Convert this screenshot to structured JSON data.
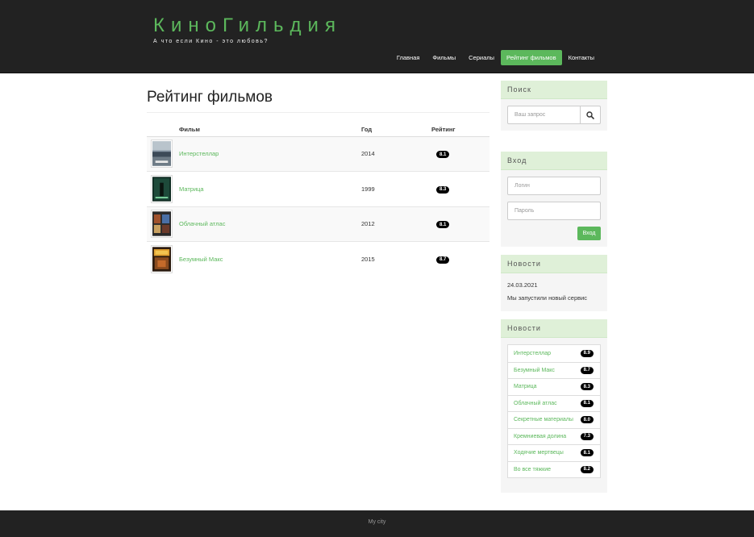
{
  "header": {
    "brand": "КиноГильдия",
    "tagline": "А что если Кино - это любовь?",
    "nav": [
      {
        "label": "Главная",
        "active": false
      },
      {
        "label": "Фильмы",
        "active": false
      },
      {
        "label": "Сериалы",
        "active": false
      },
      {
        "label": "Рейтинг фильмов",
        "active": true
      },
      {
        "label": "Контакты",
        "active": false
      }
    ]
  },
  "main": {
    "title": "Рейтинг фильмов",
    "table": {
      "headers": {
        "film": "Фильм",
        "year": "Год",
        "rating": "Рейтинг"
      },
      "rows": [
        {
          "film": "Интерстеллар",
          "year": "2014",
          "rating": "8.1",
          "poster_icon": "interstellar-poster-icon"
        },
        {
          "film": "Матрица",
          "year": "1999",
          "rating": "8.3",
          "poster_icon": "matrix-poster-icon"
        },
        {
          "film": "Облачный атлас",
          "year": "2012",
          "rating": "8.1",
          "poster_icon": "cloud-atlas-poster-icon"
        },
        {
          "film": "Безумный Макс",
          "year": "2015",
          "rating": "8.7",
          "poster_icon": "mad-max-poster-icon"
        }
      ]
    }
  },
  "sidebar": {
    "search": {
      "heading": "Поиск",
      "placeholder": "Ваш запрос"
    },
    "login": {
      "heading": "Вход",
      "login_placeholder": "Логин",
      "password_placeholder": "Пароль",
      "button": "Вход"
    },
    "news": {
      "heading": "Новости",
      "date": "24.03.2021",
      "text": "Мы запустили новый сервис"
    },
    "top": {
      "heading": "Новости",
      "items": [
        {
          "label": "Интерстеллар",
          "rating": "8.9"
        },
        {
          "label": "Безумный Макс",
          "rating": "8.7"
        },
        {
          "label": "Матрица",
          "rating": "8.3"
        },
        {
          "label": "Облачный атлас",
          "rating": "8.1"
        },
        {
          "label": "Секретные материалы",
          "rating": "8.0"
        },
        {
          "label": "Кремниевая долина",
          "rating": "7.3"
        },
        {
          "label": "Ходячие мертвецы",
          "rating": "8.1"
        },
        {
          "label": "Во все тяжкие",
          "rating": "8.2"
        }
      ]
    }
  },
  "footer": {
    "text": "My city"
  },
  "colors": {
    "accent": "#5cb85c",
    "header_bg": "#222222",
    "panel_heading_bg": "#dff0d8"
  }
}
